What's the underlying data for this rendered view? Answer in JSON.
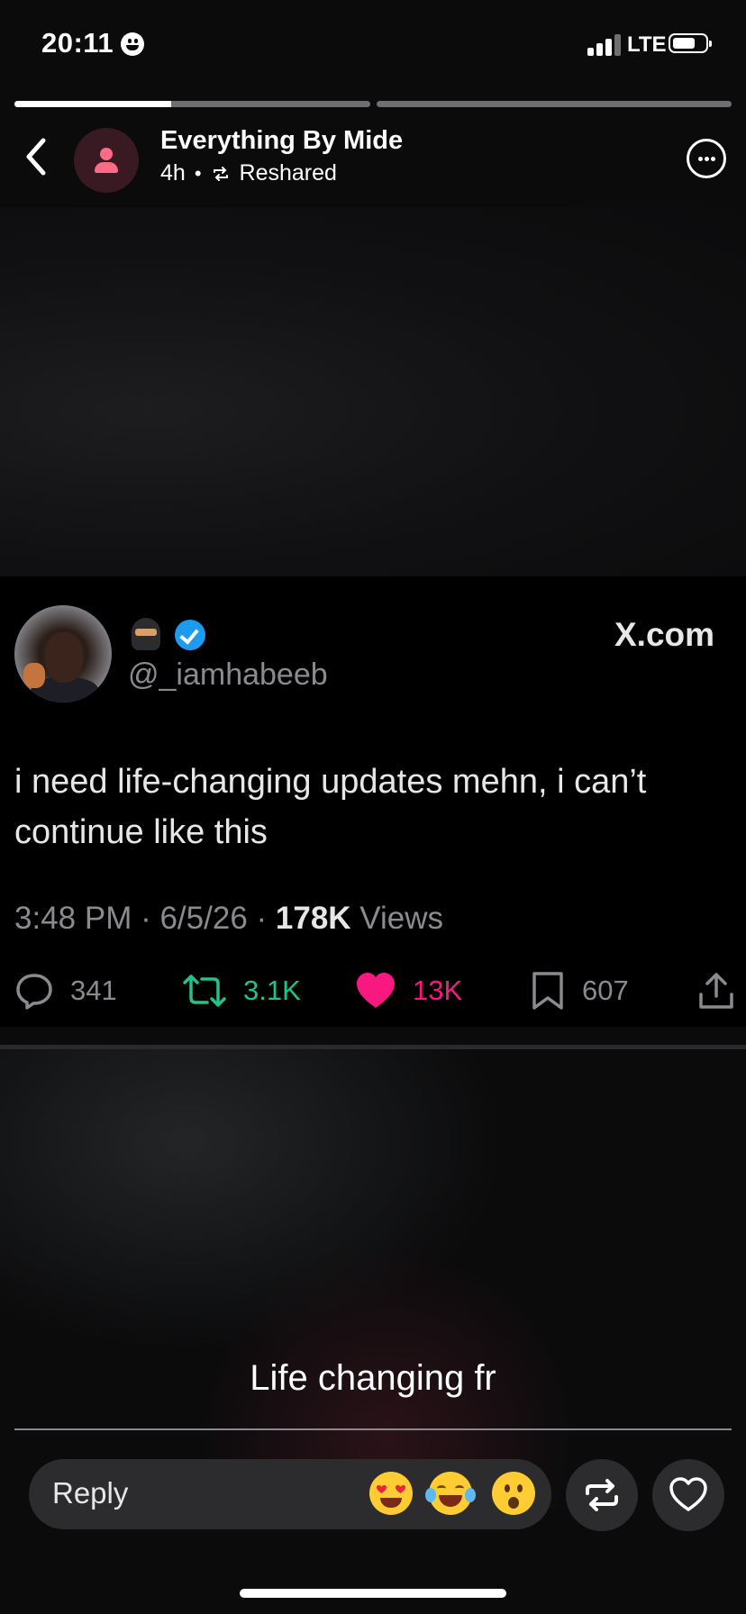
{
  "status_bar": {
    "time": "20:11",
    "network": "LTE"
  },
  "story": {
    "progress": [
      1.0,
      0.0
    ],
    "segments_fill": [
      0.44,
      0.0
    ],
    "author": "Everything By Mide",
    "age": "4h",
    "separator": "•",
    "reshare_label": "Reshared"
  },
  "tweet": {
    "handle": "@_iamhabeeb",
    "source": "X.com",
    "text": "i need life-changing updates mehn, i can’t continue like this",
    "time": "3:48 PM",
    "date": "6/5/26",
    "views_count": "178K",
    "views_label": "Views",
    "replies": "341",
    "reposts": "3.1K",
    "likes": "13K",
    "bookmarks": "607"
  },
  "caption": "Life changing fr",
  "reply_bar": {
    "placeholder": "Reply",
    "reactions": [
      "heart-eyes-emoji",
      "tears-of-joy-emoji",
      "surprised-emoji"
    ]
  },
  "colors": {
    "repost": "#23c28a",
    "like": "#f91880",
    "verified": "#1d9bf0"
  }
}
